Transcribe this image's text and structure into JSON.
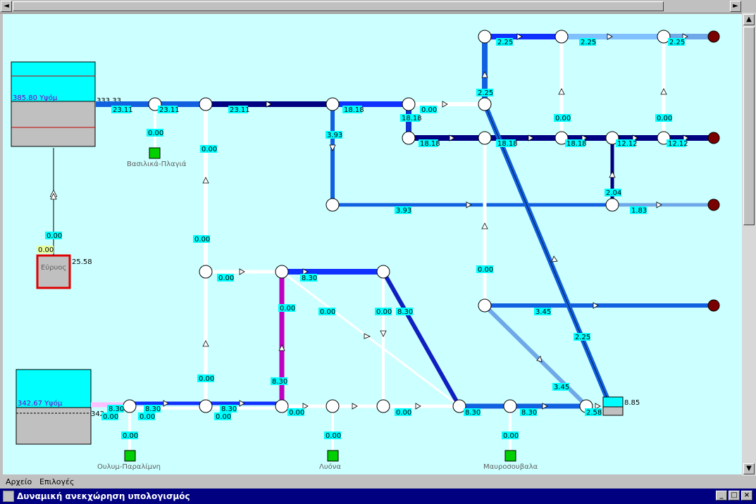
{
  "window": {
    "title": "Δυναμική ανεκχώρηση υπολογισμός",
    "menu": [
      "Αρχείο",
      "Επιλογές"
    ],
    "buttons": {
      "minimize": "_",
      "maximize": "□",
      "close": "×"
    }
  },
  "scrollbars": {
    "left_arrow": "◄",
    "right_arrow": "►",
    "up_arrow": "▲",
    "down_arrow": "▼"
  },
  "colors": {
    "canvas": "#ccffff",
    "pipe_dark": "#000080",
    "pipe_mid": "#1060e0",
    "pipe_light": "#6fa8e8",
    "pipe_magenta": "#c000c0",
    "outlet": "#7a0000",
    "source": "#00d000"
  },
  "reservoirs": {
    "top": {
      "level_label": "385.80 Υψόμ",
      "pressure": "333.33"
    },
    "bottom": {
      "level_label": "342.67 Υψόμ",
      "pressure": "342"
    }
  },
  "pump": {
    "label": "Εύρυος",
    "value": "25.58",
    "flow": "0.00",
    "flow2": "0.00"
  },
  "tank": {
    "value": "8.85"
  },
  "sources": [
    {
      "name": "Βασιλικά-Πλαγιά",
      "flow": "0.00"
    },
    {
      "name": "Ουλυμ-Παραλίμνη",
      "flow": "0.00"
    },
    {
      "name": "Λυόνα",
      "flow": "0.00"
    },
    {
      "name": "Μαυροσουβαλα",
      "flow": "0.00"
    }
  ],
  "flows": {
    "f1": "23.11",
    "f2": "23.11",
    "f3": "23.11",
    "f4": "18.18",
    "f5": "0.00",
    "f6": "18.18",
    "f7": "3.93",
    "f8": "2.25",
    "f9": "2.25",
    "f10": "2.25",
    "f11": "2.25",
    "f12": "0.00",
    "f13": "0.00",
    "f14": "18.18",
    "f15": "18.18",
    "f16": "18.18",
    "f17": "12.12",
    "f18": "12.12",
    "f19": "2.04",
    "f20": "3.93",
    "f21": "1.83",
    "f22": "0.00",
    "f23": "0.00",
    "f24": "0.00",
    "f25": "8.30",
    "f26": "0.00",
    "f27": "0.00",
    "f28": "8.30",
    "f29": "0.00",
    "f30": "3.45",
    "f31": "2.25",
    "f32": "0.00",
    "f33": "8.30",
    "f34": "8.30",
    "f35": "8.30",
    "f36": "0.00",
    "f37": "0.00",
    "f38": "8.30",
    "f39": "8.30",
    "f40": "2.58",
    "f41": "3.45",
    "f42": "0.00",
    "f43": "0.00",
    "f44": "0.00",
    "f45": "8.30",
    "f46": "0.00",
    "f47": "0.00"
  }
}
